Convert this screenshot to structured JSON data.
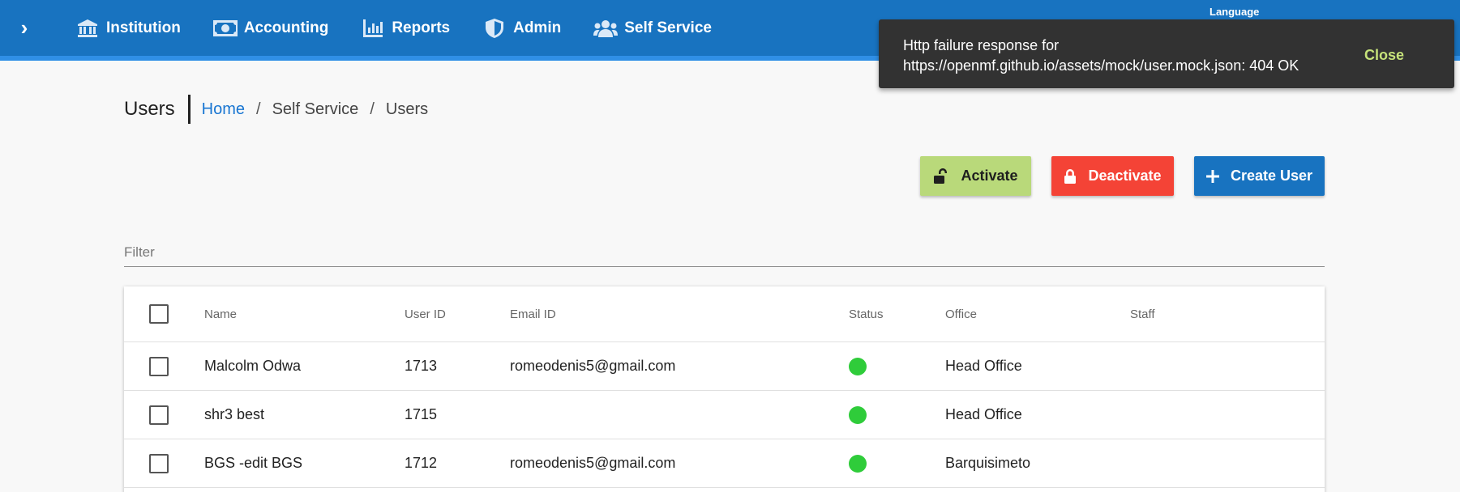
{
  "nav": {
    "items": [
      {
        "label": "Institution",
        "icon": "institution-icon"
      },
      {
        "label": "Accounting",
        "icon": "money-icon"
      },
      {
        "label": "Reports",
        "icon": "bar-chart-icon"
      },
      {
        "label": "Admin",
        "icon": "shield-icon"
      },
      {
        "label": "Self Service",
        "icon": "users-icon"
      }
    ],
    "language_label": "Language",
    "accent_color": "#1873c0"
  },
  "snackbar": {
    "message": "Http failure response for https://openmf.github.io/assets/mock/user.mock.json: 404 OK",
    "action": "Close"
  },
  "page": {
    "title": "Users",
    "breadcrumb": [
      "Home",
      "Self Service",
      "Users"
    ]
  },
  "actions": {
    "activate": "Activate",
    "deactivate": "Deactivate",
    "create": "Create User"
  },
  "filter": {
    "placeholder": "Filter"
  },
  "table": {
    "columns": [
      "Name",
      "User ID",
      "Email ID",
      "Status",
      "Office",
      "Staff"
    ],
    "rows": [
      {
        "name": "Malcolm Odwa",
        "user_id": "1713",
        "email": "romeodenis5@gmail.com",
        "status": "active",
        "office": "Head Office",
        "staff": ""
      },
      {
        "name": "shr3 best",
        "user_id": "1715",
        "email": "",
        "status": "active",
        "office": "Head Office",
        "staff": ""
      },
      {
        "name": "BGS -edit BGS",
        "user_id": "1712",
        "email": "romeodenis5@gmail.com",
        "status": "active",
        "office": "Barquisimeto",
        "staff": ""
      }
    ],
    "status_active_color": "#2fcc3a"
  }
}
